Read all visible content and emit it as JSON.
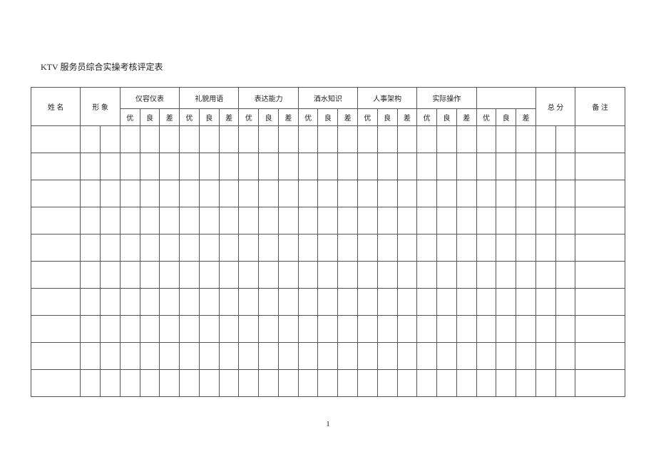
{
  "title": "KTV 服务员综合实操考核评定表",
  "headers": {
    "name": "姓 名",
    "image": "形 象",
    "appearance": "仪容仪表",
    "politeness": "礼貌用语",
    "expression": "表达能力",
    "wine": "酒水知识",
    "hr": "人事架构",
    "practical": "实际操作",
    "total": "总 分",
    "remark": "备 注"
  },
  "grades": {
    "excellent": "优",
    "good": "良",
    "poor": "差"
  },
  "pageNumber": "1",
  "emptyRows": 10
}
